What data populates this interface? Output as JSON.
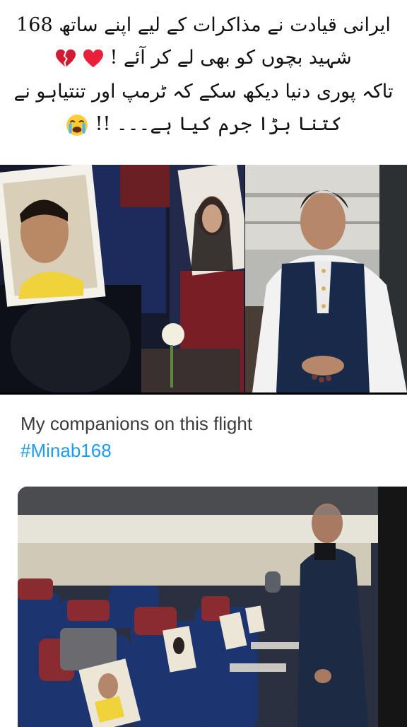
{
  "caption": {
    "line1": "ایرانی قیادت نے مذاکرات کے لیے اپنے ساتھ 168",
    "line2": "شہید بچوں کو بھی لے کر آئے !",
    "line3": "تاکہ پوری دنیا دیکھ سکے کہ ٹرمپ اور تنتیاہو نے",
    "line4": "کتنا بڑا جرم کیا ہے۔۔۔ !!",
    "emoji_line2": [
      "broken-heart-icon",
      "red-heart-icon"
    ],
    "emoji_line4": "crying-face-icon"
  },
  "tweet": {
    "text": "My companions on this flight",
    "hashtag": "#Minab168"
  },
  "colors": {
    "hashtag": "#1d9bf0",
    "text": "#3b3b3b",
    "heart": "#e8203a"
  }
}
